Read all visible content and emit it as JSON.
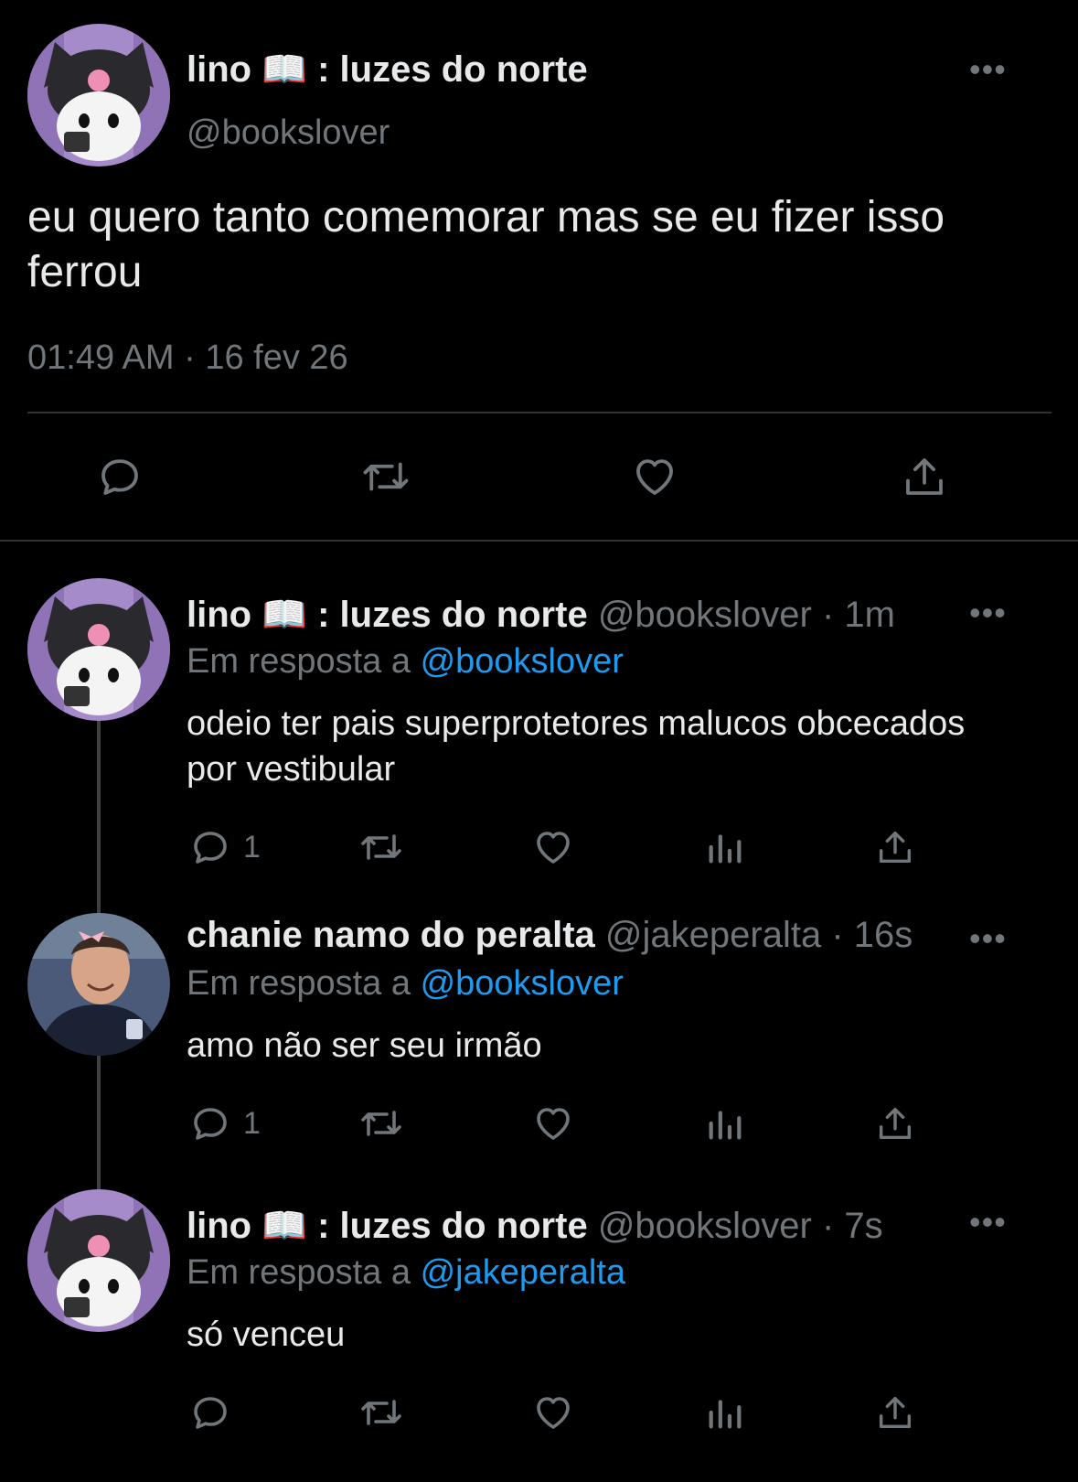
{
  "main_tweet": {
    "display_name": "lino 📖 : luzes do norte",
    "handle": "@bookslover",
    "text": "eu quero tanto comemorar mas se eu fizer isso ferrou",
    "timestamp": "01:49 AM · 16 fev 26",
    "more_icon": "more-horizontal-icon",
    "actions": [
      "reply-icon",
      "retweet-icon",
      "like-icon",
      "share-icon"
    ]
  },
  "replies": [
    {
      "display_name": "lino 📖 : luzes do norte",
      "handle": "@bookslover",
      "time": "· 1m",
      "reply_prefix": "Em resposta a",
      "reply_to": "@bookslover",
      "text": "odeio ter pais superprotetores malucos obcecados por vestibular",
      "reply_count": "1"
    },
    {
      "display_name": "chanie namo do peralta",
      "handle": "@jakeperalta",
      "time": "· 16s",
      "reply_prefix": "Em resposta a",
      "reply_to": "@bookslover",
      "text": "amo não ser seu irmão",
      "reply_count": "1"
    },
    {
      "display_name": "lino 📖 : luzes do norte",
      "handle": "@bookslover",
      "time": "· 7s",
      "reply_prefix": "Em resposta a",
      "reply_to": "@jakeperalta",
      "text": "só venceu",
      "reply_count": ""
    }
  ],
  "colors": {
    "background": "#000000",
    "text": "#e7e9ea",
    "secondary": "#71767b",
    "link": "#1d9bf0",
    "divider": "#2f3336"
  }
}
